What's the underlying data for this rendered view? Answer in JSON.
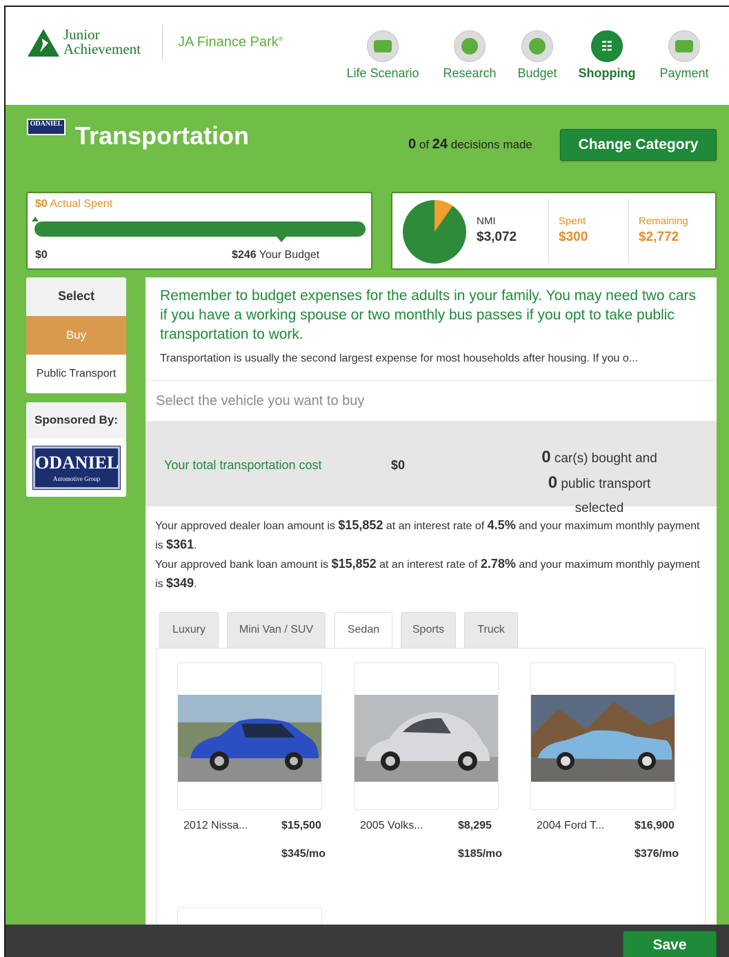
{
  "header": {
    "logo_line1": "Junior",
    "logo_line2": "Achievement",
    "park_name": "JA Finance Park",
    "park_mark": "®",
    "nav": [
      {
        "label": "Life Scenario",
        "icon": "card-icon"
      },
      {
        "label": "Research",
        "icon": "globe-icon"
      },
      {
        "label": "Budget",
        "icon": "coin-icon"
      },
      {
        "label": "Shopping",
        "icon": "cart-icon",
        "active": true
      },
      {
        "label": "Payment",
        "icon": "credit-card-icon"
      }
    ]
  },
  "sponsor_mini": "ODANIEL",
  "page": {
    "title": "Transportation",
    "decisions_made": "0",
    "decisions_total": "24",
    "decisions_of": "of",
    "decisions_suffix": "decisions made",
    "change_category": "Change Category"
  },
  "spent": {
    "actual_amount": "$0",
    "actual_label": "Actual Spent",
    "min_label": "$0",
    "budget_amount": "$246",
    "budget_label": "Your Budget",
    "progress": 0
  },
  "nmi": {
    "nmi_label": "NMI",
    "nmi_value": "$3,072",
    "spent_label": "Spent",
    "spent_value": "$300",
    "remaining_label": "Remaining",
    "remaining_value": "$2,772",
    "spent_fraction": 0.0977
  },
  "sidebar": {
    "select_label": "Select",
    "items": [
      "Buy",
      "Public Transport"
    ],
    "sponsored_by": "Sponsored By:",
    "sponsor_name": "ODANIEL",
    "sponsor_sub": "Automotive Group"
  },
  "tip": {
    "main": "Remember to budget expenses for the adults in your family. You may need two cars if you have a working spouse or two monthly bus passes if you opt to take public transportation to work.",
    "secondary": "Transportation is usually the second largest expense for most households after housing. If you o..."
  },
  "select_vehicle_placeholder": "Select the vehicle you want to buy",
  "cost": {
    "label": "Your total transportation cost",
    "amount": "$0",
    "cars_count": "0",
    "cars_text": "car(s) bought and",
    "public_count": "0",
    "public_text": "public transport selected"
  },
  "loan": {
    "dealer_pre": "Your approved dealer loan amount is",
    "dealer_amount": "$15,852",
    "dealer_mid": "at an interest rate of",
    "dealer_rate": "4.5%",
    "dealer_post": "and your maximum monthly payment is",
    "dealer_payment": "$361",
    "bank_pre": "Your approved bank loan amount is",
    "bank_amount": "$15,852",
    "bank_mid": "at an interest rate of",
    "bank_rate": "2.78%",
    "bank_post": "and your maximum monthly payment is",
    "bank_payment": "$349"
  },
  "tabs": [
    "Luxury",
    "Mini Van / SUV",
    "Sedan",
    "Sports",
    "Truck"
  ],
  "active_tab": "Sedan",
  "cars": [
    {
      "name": "2012 Nissa...",
      "price": "$15,500",
      "monthly": "$345/mo",
      "color": "#2b4fc2"
    },
    {
      "name": "2005 Volks...",
      "price": "$8,295",
      "monthly": "$185/mo",
      "color": "#c9cdd2"
    },
    {
      "name": "2004 Ford T...",
      "price": "$16,900",
      "monthly": "$376/mo",
      "color": "#7fb6e0"
    }
  ],
  "save_label": "Save"
}
